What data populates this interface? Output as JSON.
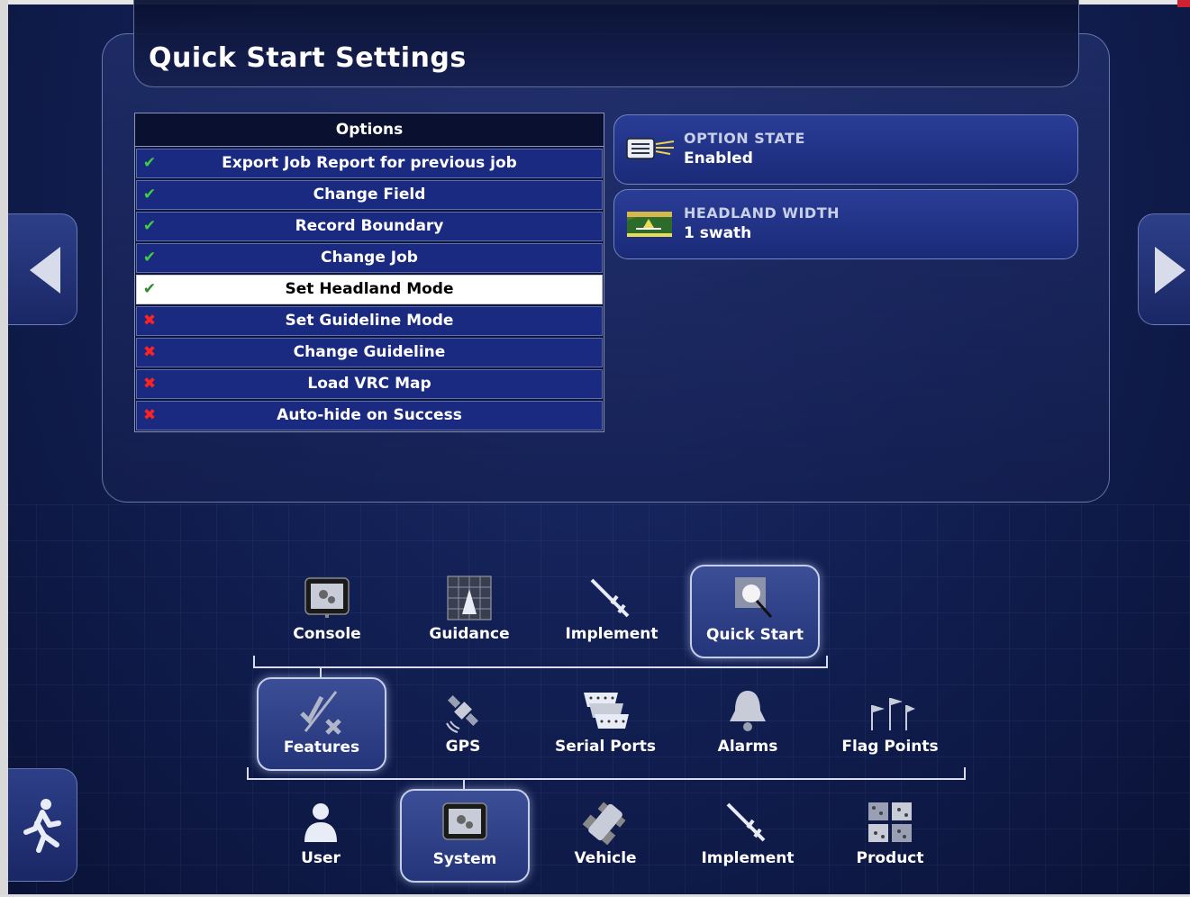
{
  "page": {
    "title": "Quick Start Settings"
  },
  "options_table": {
    "header": "Options",
    "rows": [
      {
        "label": "Export Job Report for previous job",
        "state": "enabled",
        "mark": "✔"
      },
      {
        "label": "Change Field",
        "state": "enabled",
        "mark": "✔"
      },
      {
        "label": "Record Boundary",
        "state": "enabled",
        "mark": "✔"
      },
      {
        "label": "Change Job",
        "state": "enabled",
        "mark": "✔"
      },
      {
        "label": "Set Headland Mode",
        "state": "enabled",
        "mark": "✔",
        "selected": true
      },
      {
        "label": "Set Guideline Mode",
        "state": "disabled",
        "mark": "✖"
      },
      {
        "label": "Change Guideline",
        "state": "disabled",
        "mark": "✖"
      },
      {
        "label": "Load VRC Map",
        "state": "disabled",
        "mark": "✖"
      },
      {
        "label": "Auto-hide on Success",
        "state": "disabled",
        "mark": "✖"
      }
    ]
  },
  "option_state": {
    "label": "OPTION STATE",
    "value": "Enabled",
    "icon": "list-icon"
  },
  "headland_width": {
    "label": "HEADLAND WIDTH",
    "value": "1 swath",
    "icon": "headland-icon"
  },
  "nav": {
    "row1": [
      {
        "label": "Console",
        "icon": "console-icon"
      },
      {
        "label": "Guidance",
        "icon": "guidance-icon"
      },
      {
        "label": "Implement",
        "icon": "implement-icon"
      },
      {
        "label": "Quick Start",
        "icon": "quick-start-icon",
        "active": true
      }
    ],
    "row2": [
      {
        "label": "Features",
        "icon": "features-icon",
        "active": true
      },
      {
        "label": "GPS",
        "icon": "satellite-icon"
      },
      {
        "label": "Serial Ports",
        "icon": "serial-ports-icon"
      },
      {
        "label": "Alarms",
        "icon": "bell-icon"
      },
      {
        "label": "Flag Points",
        "icon": "flags-icon"
      }
    ],
    "row3": [
      {
        "label": "User",
        "icon": "user-icon"
      },
      {
        "label": "System",
        "icon": "system-icon",
        "active": true
      },
      {
        "label": "Vehicle",
        "icon": "vehicle-icon"
      },
      {
        "label": "Implement",
        "icon": "implement-icon"
      },
      {
        "label": "Product",
        "icon": "product-icon"
      }
    ]
  },
  "side_buttons": {
    "left": "arrow-left-icon",
    "right": "arrow-right-icon",
    "exit": "exit-icon"
  },
  "colors": {
    "background": "#122055",
    "row": "#1a2a80",
    "check": "#3fcf3f",
    "cross": "#ff2222"
  }
}
